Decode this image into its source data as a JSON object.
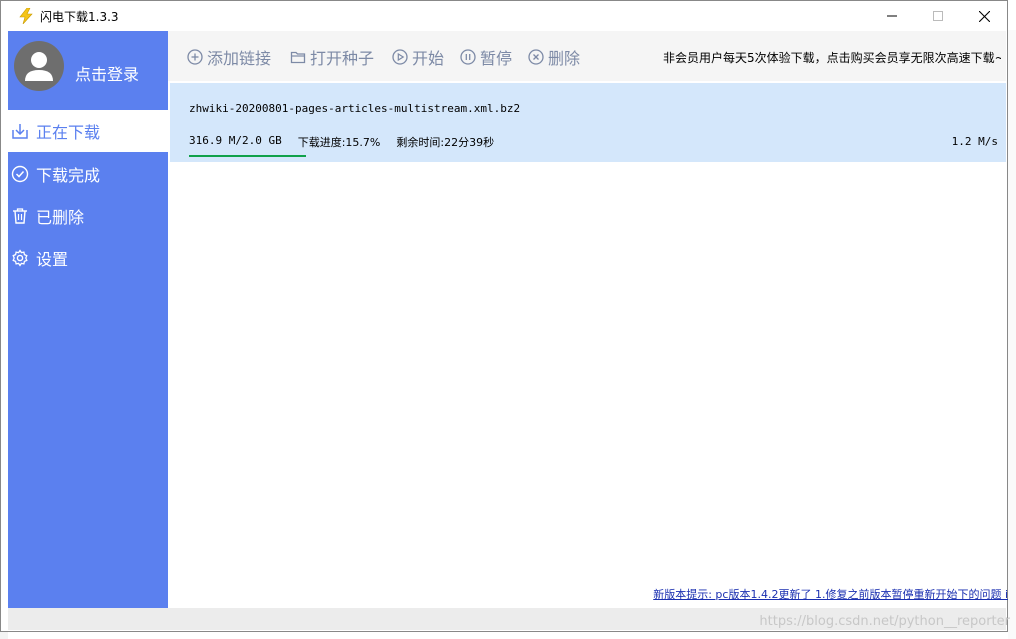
{
  "window": {
    "title": "闪电下载1.3.3",
    "controls": {
      "minimize": "—",
      "maximize": "☐",
      "close": "✕"
    }
  },
  "sidebar": {
    "login_text": "点击登录",
    "items": [
      {
        "label": "正在下载",
        "icon": "download-icon",
        "active": true
      },
      {
        "label": "下载完成",
        "icon": "check-circle-icon",
        "active": false
      },
      {
        "label": "已删除",
        "icon": "trash-icon",
        "active": false
      },
      {
        "label": "设置",
        "icon": "gear-icon",
        "active": false
      }
    ]
  },
  "toolbar": {
    "add_link": "添加链接",
    "open_torrent": "打开种子",
    "start": "开始",
    "pause": "暂停",
    "delete": "删除",
    "notice": "非会员用户每天5次体验下载，点击购买会员享无限次高速下载~"
  },
  "downloads": [
    {
      "filename": "zhwiki-20200801-pages-articles-multistream.xml.bz2",
      "size": "316.9 M/2.0 GB",
      "progress_text": "下载进度:15.7%",
      "remaining": "剩余时间:22分39秒",
      "speed": "1.2 M/s",
      "progress": 0.145
    }
  ],
  "footer": {
    "update_notice": "新版本提示: pc版本1.4.2更新了 1.修复之前版本暂停重新开始下的问题 i"
  },
  "watermark": "https://blog.csdn.net/python__reporter",
  "colors": {
    "sidebar": "#5b80ef",
    "row_bg": "#d4e7fb",
    "progress": "#10a14a",
    "toolbar_text": "#7d8aa6"
  }
}
